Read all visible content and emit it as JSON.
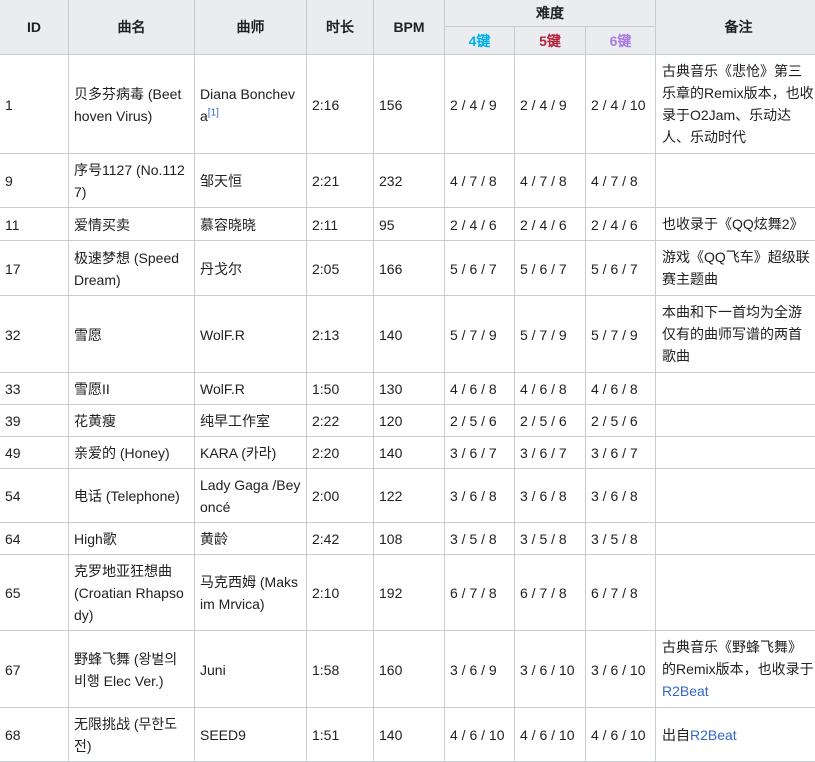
{
  "headers": {
    "id": "ID",
    "title": "曲名",
    "artist": "曲师",
    "duration": "时长",
    "bpm": "BPM",
    "difficulty": "难度",
    "k4": "4键",
    "k5": "5键",
    "k6": "6键",
    "notes": "备注"
  },
  "colors": {
    "k4": "#00b1e8",
    "k5": "#b3243c",
    "k6": "#a77be0",
    "link": "#3366cc"
  },
  "rows": [
    {
      "id": "1",
      "title": "贝多芬病毒 (Beethoven Virus)",
      "artist": "Diana Boncheva",
      "artist_ref": "[1]",
      "duration": "2:16",
      "bpm": "156",
      "k4": "2 / 4 / 9",
      "k5": "2 / 4 / 9",
      "k6": "2 / 4 / 10",
      "note": "古典音乐《悲怆》第三乐章的Remix版本，也收录于O2Jam、乐动达人、乐动时代"
    },
    {
      "id": "9",
      "title": "序号1127 (No.1127)",
      "artist": "邹天恒",
      "duration": "2:21",
      "bpm": "232",
      "k4": "4 / 7 / 8",
      "k5": "4 / 7 / 8",
      "k6": "4 / 7 / 8",
      "note": ""
    },
    {
      "id": "11",
      "title": "爱情买卖",
      "artist": "慕容晓晓",
      "duration": "2:11",
      "bpm": "95",
      "k4": "2 / 4 / 6",
      "k5": "2 / 4 / 6",
      "k6": "2 / 4 / 6",
      "note": "也收录于《QQ炫舞2》"
    },
    {
      "id": "17",
      "title": "极速梦想 (Speed Dream)",
      "artist": "丹戈尔",
      "duration": "2:05",
      "bpm": "166",
      "k4": "5 / 6 / 7",
      "k5": "5 / 6 / 7",
      "k6": "5 / 6 / 7",
      "note": "游戏《QQ飞车》超级联赛主题曲"
    },
    {
      "id": "32",
      "title": "雪愿",
      "artist": "WolF.R",
      "duration": "2:13",
      "bpm": "140",
      "k4": "5 / 7 / 9",
      "k5": "5 / 7 / 9",
      "k6": "5 / 7 / 9",
      "note": "本曲和下一首均为全游仅有的曲师写谱的两首歌曲"
    },
    {
      "id": "33",
      "title": "雪愿II",
      "artist": "WolF.R",
      "duration": "1:50",
      "bpm": "130",
      "k4": "4 / 6 / 8",
      "k5": "4 / 6 / 8",
      "k6": "4 / 6 / 8",
      "note": ""
    },
    {
      "id": "39",
      "title": "花黄瘦",
      "artist": "纯早工作室",
      "duration": "2:22",
      "bpm": "120",
      "k4": "2 / 5 / 6",
      "k5": "2 / 5 / 6",
      "k6": "2 / 5 / 6",
      "note": ""
    },
    {
      "id": "49",
      "title": "亲爱的 (Honey)",
      "artist": "KARA (카라)",
      "duration": "2:20",
      "bpm": "140",
      "k4": "3 / 6 / 7",
      "k5": "3 / 6 / 7",
      "k6": "3 / 6 / 7",
      "note": ""
    },
    {
      "id": "54",
      "title": "电话 (Telephone)",
      "artist": "Lady Gaga /Beyoncé",
      "duration": "2:00",
      "bpm": "122",
      "k4": "3 / 6 / 8",
      "k5": "3 / 6 / 8",
      "k6": "3 / 6 / 8",
      "note": ""
    },
    {
      "id": "64",
      "title": "High歌",
      "artist": "黄龄",
      "duration": "2:42",
      "bpm": "108",
      "k4": "3 / 5 / 8",
      "k5": "3 / 5 / 8",
      "k6": "3 / 5 / 8",
      "note": ""
    },
    {
      "id": "65",
      "title": "克罗地亚狂想曲 (Croatian Rhapsody)",
      "artist": "马克西姆 (Maksim Mrvica)",
      "duration": "2:10",
      "bpm": "192",
      "k4": "6 / 7 / 8",
      "k5": "6 / 7 / 8",
      "k6": "6 / 7 / 8",
      "note": ""
    },
    {
      "id": "67",
      "title": "野蜂飞舞 (왕벌의 비행 Elec Ver.)",
      "artist": "Juni",
      "duration": "1:58",
      "bpm": "160",
      "k4": "3 / 6 / 9",
      "k5": "3 / 6 / 10",
      "k6": "3 / 6 / 10",
      "note": "古典音乐《野蜂飞舞》的Remix版本，也收录于",
      "note_link": "R2Beat"
    },
    {
      "id": "68",
      "title": "无限挑战 (무한도전)",
      "artist": "SEED9",
      "duration": "1:51",
      "bpm": "140",
      "k4": "4 / 6 / 10",
      "k5": "4 / 6 / 10",
      "k6": "4 / 6 / 10",
      "note": "出自",
      "note_link": "R2Beat"
    }
  ]
}
